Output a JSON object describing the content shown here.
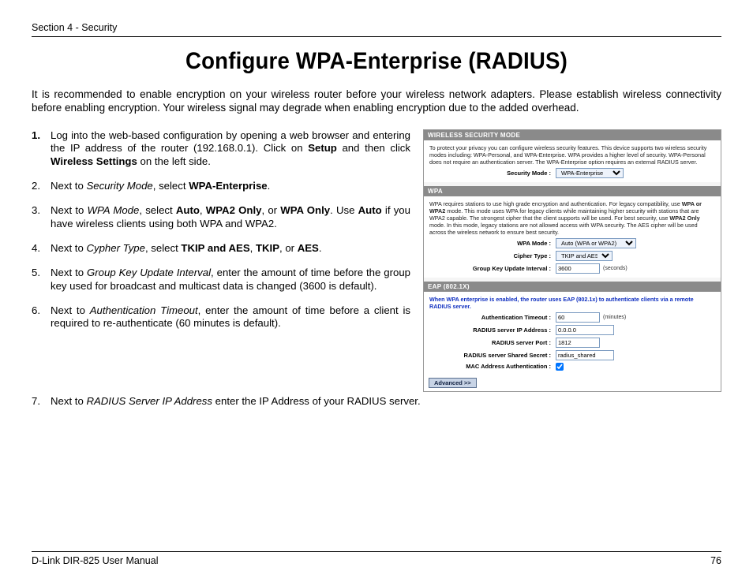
{
  "header": {
    "section": "Section 4 - Security"
  },
  "title": "Configure WPA-Enterprise (RADIUS)",
  "intro": "It is recommended to enable encryption on your wireless router before your wireless network adapters. Please establish wireless connectivity before enabling encryption. Your wireless signal may degrade when enabling encryption due to the added overhead.",
  "steps": {
    "s1_num": "1.",
    "s1_a": "Log into the web-based configuration by opening a web browser and entering the IP address of the router (192.168.0.1).  Click on ",
    "s1_b1": "Setup",
    "s1_c": " and then click ",
    "s1_b2": "Wireless Settings",
    "s1_d": " on the left side.",
    "s2_num": "2.",
    "s2_a": "Next to ",
    "s2_i": "Security Mode",
    "s2_b": ", select ",
    "s2_b1": "WPA-Enterprise",
    "s2_c": ".",
    "s3_num": "3.",
    "s3_a": "Next to ",
    "s3_i": "WPA Mode",
    "s3_b": ", select ",
    "s3_b1": "Auto",
    "s3_c": ", ",
    "s3_b2": "WPA2 Only",
    "s3_d": ", or ",
    "s3_b3": "WPA Only",
    "s3_e": ". Use ",
    "s3_b4": "Auto",
    "s3_f": " if you have wireless clients using both WPA and WPA2.",
    "s4_num": "4.",
    "s4_a": "Next to ",
    "s4_i": "Cypher Type",
    "s4_b": ", select ",
    "s4_b1": "TKIP and AES",
    "s4_c": ", ",
    "s4_b2": "TKIP",
    "s4_d": ", or ",
    "s4_b3": "AES",
    "s4_e": ".",
    "s5_num": "5.",
    "s5_a": "Next to ",
    "s5_i": "Group Key Update Interval",
    "s5_b": ", enter the amount of time before the group key used for broadcast and multicast data is changed (3600 is default).",
    "s6_num": "6.",
    "s6_a": "Next to ",
    "s6_i": "Authentication Timeout",
    "s6_b": ", enter the amount of time before a client is required to re-authenticate (60 minutes is default).",
    "s7_num": "7.",
    "s7_a": "Next to ",
    "s7_i": "RADIUS Server IP Address",
    "s7_b": " enter the IP Address of your RADIUS server."
  },
  "panel": {
    "bar1": "WIRELESS SECURITY MODE",
    "desc1": "To protect your privacy you can configure wireless security features. This device supports two wireless security modes including: WPA-Personal, and WPA-Enterprise. WPA provides a higher level of security. WPA-Personal does not require an authentication server. The WPA-Enterprise option requires an external RADIUS server.",
    "lbl_secmode": "Security Mode :",
    "val_secmode": "WPA-Enterprise",
    "bar2": "WPA",
    "desc2_a": "WPA requires stations to use high grade encryption and authentication. For legacy compatibility, use ",
    "desc2_b1": "WPA or WPA2",
    "desc2_b": " mode. This mode uses WPA for legacy clients while maintaining higher security with stations that are WPA2 capable. The strongest cipher that the client supports will be used. For best security, use ",
    "desc2_b2": "WPA2 Only",
    "desc2_c": " mode. In this mode, legacy stations are not allowed access with WPA security. The AES cipher will be used across the wireless network to ensure best security.",
    "lbl_wpamode": "WPA Mode :",
    "val_wpamode": "Auto (WPA or WPA2)",
    "lbl_cipher": "Cipher Type :",
    "val_cipher": "TKIP and AES",
    "lbl_group": "Group Key Update Interval :",
    "val_group": "3600",
    "unit_group": "(seconds)",
    "bar3": "EAP (802.1X)",
    "desc3": "When WPA enterprise is enabled, the router uses EAP (802.1x) to authenticate clients via a remote RADIUS server.",
    "lbl_auth": "Authentication Timeout :",
    "val_auth": "60",
    "unit_auth": "(minutes)",
    "lbl_radip": "RADIUS server IP Address :",
    "val_radip": "0.0.0.0",
    "lbl_radport": "RADIUS server Port :",
    "val_radport": "1812",
    "lbl_radsec": "RADIUS server Shared Secret :",
    "val_radsec": "radius_shared",
    "lbl_mac": "MAC Address Authentication :",
    "adv": "Advanced >>"
  },
  "footer": {
    "left": "D-Link DIR-825 User Manual",
    "right": "76"
  }
}
